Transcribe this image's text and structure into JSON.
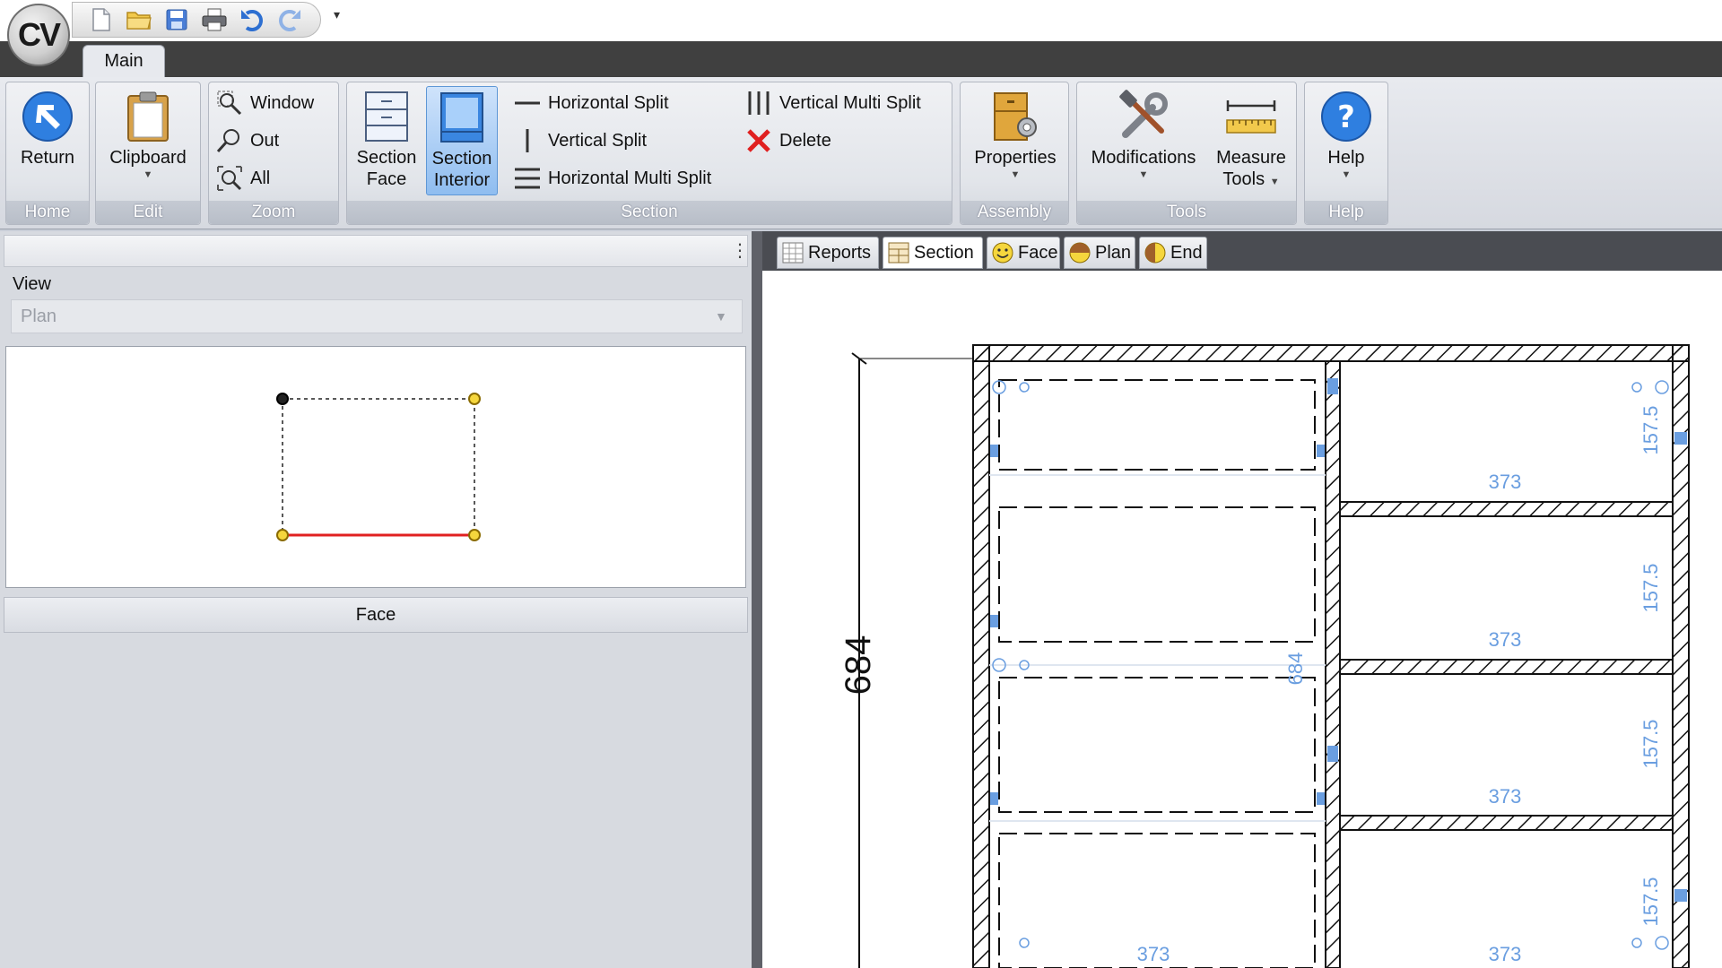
{
  "app": {
    "logo_text": "CV"
  },
  "quick_access": {
    "items": [
      "new-file-icon",
      "open-folder-icon",
      "save-icon",
      "print-icon",
      "undo-icon",
      "redo-icon"
    ],
    "more": "▾"
  },
  "tabs": {
    "main": "Main"
  },
  "ribbon": {
    "home": {
      "label": "Home",
      "return": "Return"
    },
    "edit": {
      "label": "Edit",
      "clipboard": "Clipboard"
    },
    "zoom": {
      "label": "Zoom",
      "window": "Window",
      "out": "Out",
      "all": "All"
    },
    "section": {
      "label": "Section",
      "face_line1": "Section",
      "face_line2": "Face",
      "interior_line1": "Section",
      "interior_line2": "Interior",
      "horizontal_split": "Horizontal Split",
      "vertical_split": "Vertical Split",
      "horizontal_multi_split": "Horizontal Multi Split",
      "vertical_multi_split": "Vertical Multi Split",
      "delete": "Delete"
    },
    "assembly": {
      "label": "Assembly",
      "properties": "Properties"
    },
    "tools": {
      "label": "Tools",
      "modifications": "Modifications",
      "measure_line1": "Measure",
      "measure_line2": "Tools"
    },
    "help": {
      "label": "Help",
      "help": "Help"
    }
  },
  "left_panel": {
    "menu_glyph": "⋮",
    "view_label": "View",
    "view_value": "Plan",
    "face_button": "Face"
  },
  "doc_tabs": {
    "reports": "Reports",
    "section": "Section",
    "face": "Face",
    "plan": "Plan",
    "end": "End"
  },
  "drawing": {
    "overall_height": "684",
    "inner_height": "684",
    "shelf_height": "157.5",
    "width_label": "373"
  },
  "colors": {
    "accent_blue": "#3b7fd6",
    "dimension_blue": "#6a9ee0",
    "selection_red": "#e02020",
    "active_tab": "#8fbdf0"
  }
}
